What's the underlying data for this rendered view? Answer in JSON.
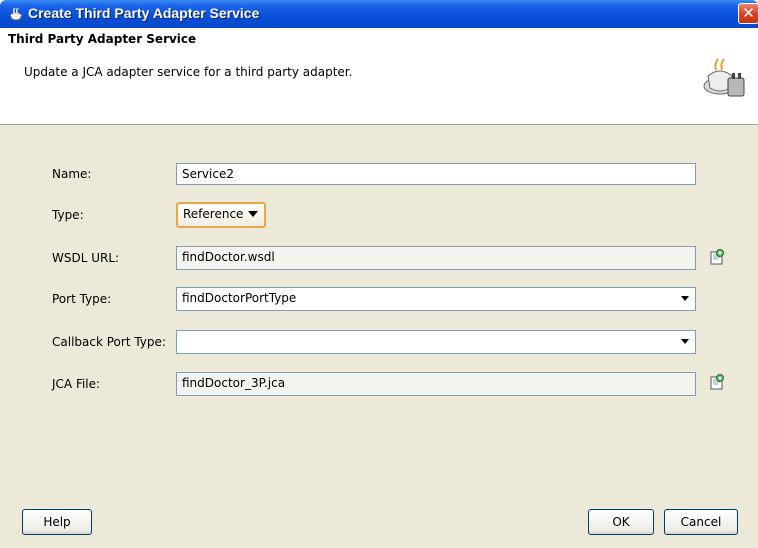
{
  "window": {
    "title": "Create Third Party Adapter Service",
    "close_icon": "close-icon"
  },
  "header": {
    "title": "Third Party Adapter Service",
    "description": "Update a JCA adapter service for a third party adapter.",
    "icon": "adapter-plug-icon"
  },
  "form": {
    "name": {
      "label": "Name:",
      "value": "Service2"
    },
    "type": {
      "label": "Type:",
      "value": "Reference"
    },
    "wsdl_url": {
      "label": "WSDL URL:",
      "value": "findDoctor.wsdl"
    },
    "port_type": {
      "label": "Port Type:",
      "value": "findDoctorPortType"
    },
    "callback_port_type": {
      "label": "Callback Port Type:",
      "value": ""
    },
    "jca_file": {
      "label": "JCA File:",
      "value": "findDoctor_3P.jca"
    }
  },
  "buttons": {
    "help": "Help",
    "ok": "OK",
    "cancel": "Cancel"
  },
  "colors": {
    "titlebar": "#0a4fd9",
    "dialog_bg": "#ece9d8",
    "focus_border": "#e5a84a"
  }
}
